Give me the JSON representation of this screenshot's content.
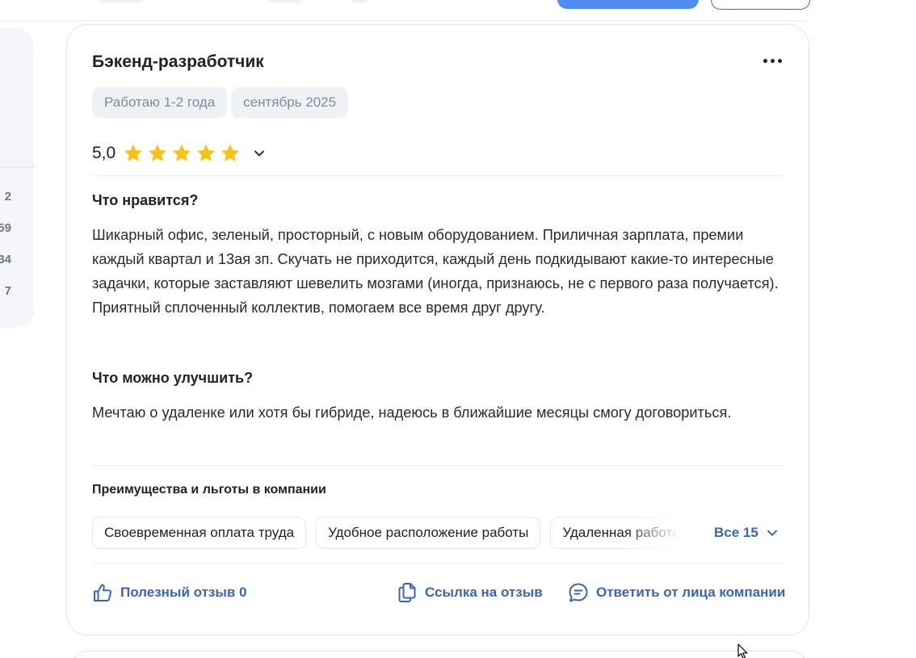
{
  "sidebar": {
    "numbers": [
      "2",
      "59",
      "34",
      "7"
    ]
  },
  "review": {
    "title": "Бэкенд-разработчик",
    "tags": [
      "Работаю 1-2 года",
      "сентябрь 2025"
    ],
    "rating": {
      "value": "5,0",
      "stars_filled": 5,
      "stars_total": 5,
      "star_color": "#f7c21a"
    },
    "likes_title": "Что нравится?",
    "likes_text": "Шикарный офис, зеленый, просторный, с новым оборудованием. Приличная зарплата, премии каждый квартал и 13ая зп. Скучать не приходится, каждый день подкидывают какие-то интересные задачки, которые заставляют шевелить мозгами (иногда, признаюсь, не с первого раза получается). Приятный сплоченный коллектив, помогаем все время друг другу.",
    "improve_title": "Что можно улучшить?",
    "improve_text": "Мечтаю о удаленке или хотя бы гибриде, надеюсь в ближайшие месяцы смогу договориться.",
    "benefits_title": "Преимущества и льготы в компании",
    "benefits": [
      "Своевременная оплата труда",
      "Удобное расположение работы",
      "Удаленная работа"
    ],
    "benefits_all": "Все 15",
    "actions": {
      "helpful": "Полезный отзыв 0",
      "link": "Ссылка на отзыв",
      "reply": "Ответить от лица компании"
    }
  },
  "colors": {
    "accent": "#3b66a8",
    "primary_button": "#4f8cf0",
    "tag_background": "#eef1f5"
  },
  "icons": [
    "more-dots-icon",
    "star-icon",
    "chevron-down-icon",
    "thumb-up-icon",
    "copy-link-icon",
    "chat-reply-icon"
  ]
}
